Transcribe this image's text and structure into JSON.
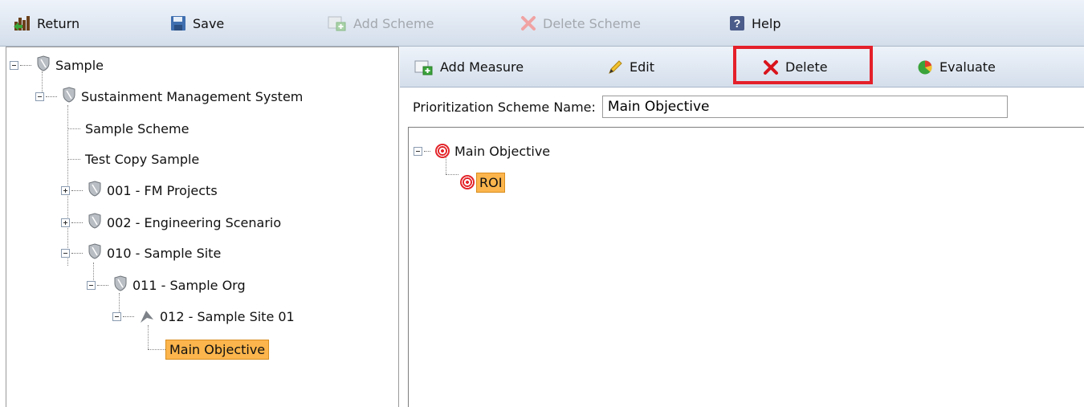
{
  "toolbar": {
    "return_label": "Return",
    "save_label": "Save",
    "add_scheme_label": "Add Scheme",
    "delete_scheme_label": "Delete Scheme",
    "help_label": "Help"
  },
  "tree": {
    "root": "Sample",
    "sms": "Sustainment Management System",
    "scheme1": "Sample Scheme",
    "scheme2": "Test Copy Sample",
    "fm_projects": "001 - FM Projects",
    "eng_scenario": "002 - Engineering Scenario",
    "sample_site": "010 - Sample Site",
    "sample_org": "011 - Sample Org",
    "sample_site01": "012 - Sample Site 01",
    "main_objective": "Main Objective"
  },
  "subtoolbar": {
    "add_measure_label": "Add Measure",
    "edit_label": "Edit",
    "delete_label": "Delete",
    "evaluate_label": "Evaluate"
  },
  "scheme": {
    "name_label": "Prioritization Scheme Name:",
    "name_value": "Main Objective"
  },
  "objectives": {
    "root": "Main Objective",
    "child": "ROI"
  },
  "colors": {
    "selection": "#fbb54c",
    "highlight": "#e4202a",
    "toolbar": "#dde6f1"
  }
}
